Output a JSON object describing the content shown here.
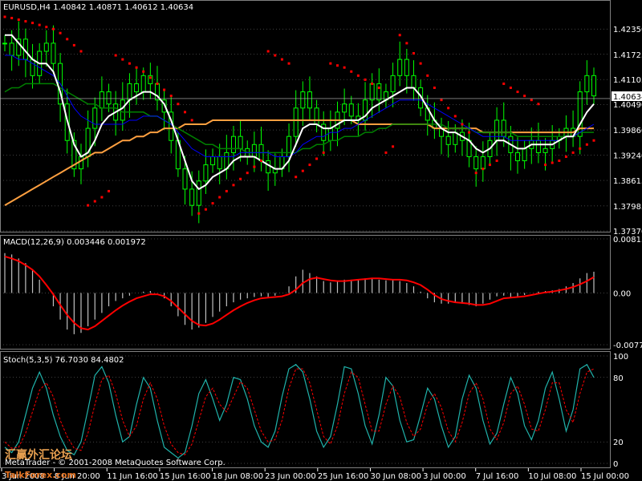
{
  "chart_data": {
    "type": "line",
    "symbol": "EURUSD,H4",
    "colors": {
      "background": "#000000",
      "candle_up": "#00ff00",
      "candle_down": "#00ff00",
      "ma_fast": "#ffffff",
      "ma_mid": "#0000ff",
      "ma_slow": "#008000",
      "ma_long": "#ffa040",
      "psar": "#ff0000",
      "macd_hist": "#c0c0c0",
      "macd_signal": "#ff0000",
      "stoch_main": "#20b2aa",
      "stoch_signal": "#ff0000",
      "grid": "#808080",
      "price_line": "#c0c0c0"
    },
    "price_pane": {
      "header": "EURUSD,H4  1.40842 1.40871 1.40612 1.40634",
      "current_price": "1.40634",
      "y_ticks": [
        "1.42350",
        "1.41725",
        "1.41105",
        "1.40490",
        "1.39860",
        "1.39240",
        "1.38615",
        "1.37985",
        "1.37370"
      ],
      "ylim": [
        1.3737,
        1.4267
      ]
    },
    "macd_pane": {
      "header": "MACD(12,26,9) 0.003446 0.001972",
      "y_ticks": [
        "0.008138",
        "0.00",
        "-0.00778"
      ],
      "ylim": [
        -0.00778,
        0.008138
      ]
    },
    "stoch_pane": {
      "header": "Stoch(5,3,5) 76.7030 84.4802",
      "y_ticks": [
        "100",
        "80",
        "20",
        "0"
      ],
      "ylim": [
        0,
        100
      ]
    },
    "x_ticks": [
      "3 Jun 2008",
      "8 Jun 20:00",
      "11 Jun 16:00",
      "15 Jun 16:00",
      "18 Jun 08:00",
      "23 Jun 00:00",
      "25 Jun 16:00",
      "30 Jun 08:00",
      "3 Jul 00:00",
      "7 Jul 16:00",
      "10 Jul 08:00",
      "15 Jul 00:00"
    ],
    "close": [
      1.42,
      1.417,
      1.421,
      1.416,
      1.412,
      1.418,
      1.42,
      1.415,
      1.405,
      1.396,
      1.389,
      1.392,
      1.399,
      1.404,
      1.408,
      1.405,
      1.401,
      1.406,
      1.41,
      1.408,
      1.412,
      1.41,
      1.406,
      1.403,
      1.396,
      1.389,
      1.384,
      1.38,
      1.386,
      1.39,
      1.392,
      1.389,
      1.393,
      1.397,
      1.394,
      1.392,
      1.395,
      1.391,
      1.388,
      1.389,
      1.392,
      1.397,
      1.404,
      1.408,
      1.404,
      1.4,
      1.396,
      1.399,
      1.403,
      1.405,
      1.402,
      1.401,
      1.406,
      1.41,
      1.406,
      1.408,
      1.412,
      1.416,
      1.412,
      1.409,
      1.404,
      1.401,
      1.399,
      1.397,
      1.395,
      1.398,
      1.396,
      1.392,
      1.389,
      1.392,
      1.396,
      1.401,
      1.397,
      1.393,
      1.391,
      1.394,
      1.396,
      1.393,
      1.394,
      1.396,
      1.397,
      1.399,
      1.397,
      1.408,
      1.412,
      1.407
    ],
    "fast_ma": [
      1.422,
      1.422,
      1.42,
      1.418,
      1.416,
      1.415,
      1.415,
      1.413,
      1.408,
      1.401,
      1.395,
      1.392,
      1.393,
      1.396,
      1.4,
      1.402,
      1.403,
      1.404,
      1.406,
      1.407,
      1.408,
      1.408,
      1.407,
      1.405,
      1.401,
      1.396,
      1.391,
      1.386,
      1.384,
      1.385,
      1.387,
      1.388,
      1.389,
      1.391,
      1.392,
      1.392,
      1.392,
      1.391,
      1.39,
      1.389,
      1.389,
      1.391,
      1.395,
      1.399,
      1.4,
      1.4,
      1.399,
      1.399,
      1.4,
      1.401,
      1.401,
      1.401,
      1.402,
      1.404,
      1.405,
      1.406,
      1.407,
      1.408,
      1.409,
      1.409,
      1.407,
      1.404,
      1.401,
      1.399,
      1.398,
      1.398,
      1.397,
      1.396,
      1.394,
      1.393,
      1.394,
      1.396,
      1.396,
      1.395,
      1.394,
      1.394,
      1.395,
      1.395,
      1.395,
      1.395,
      1.396,
      1.397,
      1.397,
      1.4,
      1.403,
      1.405
    ],
    "mid_ma": [
      1.417,
      1.417,
      1.416,
      1.416,
      1.415,
      1.414,
      1.413,
      1.412,
      1.41,
      1.407,
      1.404,
      1.402,
      1.401,
      1.4,
      1.4,
      1.4,
      1.4,
      1.4,
      1.401,
      1.401,
      1.402,
      1.402,
      1.402,
      1.401,
      1.4,
      1.398,
      1.396,
      1.394,
      1.393,
      1.392,
      1.392,
      1.392,
      1.392,
      1.392,
      1.393,
      1.393,
      1.393,
      1.393,
      1.393,
      1.392,
      1.392,
      1.392,
      1.393,
      1.395,
      1.396,
      1.397,
      1.397,
      1.398,
      1.398,
      1.399,
      1.399,
      1.4,
      1.401,
      1.402,
      1.403,
      1.404,
      1.405,
      1.406,
      1.406,
      1.406,
      1.406,
      1.405,
      1.404,
      1.403,
      1.402,
      1.401,
      1.4,
      1.399,
      1.398,
      1.397,
      1.397,
      1.397,
      1.397,
      1.396,
      1.396,
      1.396,
      1.396,
      1.396,
      1.396,
      1.396,
      1.396,
      1.397,
      1.397,
      1.398,
      1.399,
      1.4
    ],
    "slow_ma": [
      1.408,
      1.409,
      1.409,
      1.41,
      1.41,
      1.41,
      1.41,
      1.41,
      1.409,
      1.408,
      1.407,
      1.406,
      1.405,
      1.405,
      1.404,
      1.404,
      1.404,
      1.403,
      1.403,
      1.403,
      1.403,
      1.402,
      1.402,
      1.401,
      1.4,
      1.399,
      1.398,
      1.397,
      1.396,
      1.395,
      1.395,
      1.394,
      1.394,
      1.394,
      1.394,
      1.393,
      1.393,
      1.393,
      1.393,
      1.393,
      1.393,
      1.393,
      1.393,
      1.394,
      1.394,
      1.395,
      1.395,
      1.396,
      1.396,
      1.397,
      1.397,
      1.397,
      1.398,
      1.398,
      1.399,
      1.399,
      1.4,
      1.4,
      1.4,
      1.4,
      1.4,
      1.4,
      1.4,
      1.4,
      1.399,
      1.399,
      1.399,
      1.399,
      1.398,
      1.398,
      1.398,
      1.398,
      1.398,
      1.398,
      1.397,
      1.397,
      1.397,
      1.397,
      1.397,
      1.397,
      1.397,
      1.397,
      1.397,
      1.398,
      1.398,
      1.398
    ],
    "long_ma": [
      1.38,
      1.381,
      1.382,
      1.383,
      1.384,
      1.385,
      1.386,
      1.387,
      1.388,
      1.389,
      1.39,
      1.391,
      1.392,
      1.393,
      1.393,
      1.394,
      1.395,
      1.396,
      1.396,
      1.397,
      1.397,
      1.398,
      1.398,
      1.399,
      1.399,
      1.399,
      1.4,
      1.4,
      1.4,
      1.4,
      1.401,
      1.401,
      1.401,
      1.401,
      1.401,
      1.401,
      1.401,
      1.401,
      1.401,
      1.401,
      1.401,
      1.401,
      1.401,
      1.401,
      1.401,
      1.401,
      1.401,
      1.401,
      1.401,
      1.401,
      1.401,
      1.4,
      1.4,
      1.4,
      1.4,
      1.4,
      1.4,
      1.4,
      1.4,
      1.4,
      1.4,
      1.4,
      1.399,
      1.399,
      1.399,
      1.399,
      1.399,
      1.399,
      1.399,
      1.398,
      1.398,
      1.398,
      1.398,
      1.398,
      1.398,
      1.398,
      1.398,
      1.398,
      1.398,
      1.398,
      1.398,
      1.398,
      1.398,
      1.399,
      1.399,
      1.399
    ],
    "macd_hist": [
      0.006,
      0.0058,
      0.0052,
      0.0045,
      0.0035,
      0.002,
      0.0,
      -0.002,
      -0.004,
      -0.0055,
      -0.0062,
      -0.006,
      -0.005,
      -0.004,
      -0.003,
      -0.002,
      -0.0012,
      -0.0008,
      -0.0004,
      0.0,
      0.0002,
      0.0003,
      0.0,
      -0.0008,
      -0.002,
      -0.0035,
      -0.0048,
      -0.0055,
      -0.0052,
      -0.0045,
      -0.0036,
      -0.0028,
      -0.002,
      -0.0014,
      -0.001,
      -0.0008,
      -0.0006,
      -0.0005,
      -0.0006,
      -0.0004,
      0.0,
      0.001,
      0.0025,
      0.0035,
      0.003,
      0.0025,
      0.0018,
      0.0016,
      0.0018,
      0.002,
      0.002,
      0.0021,
      0.0022,
      0.0022,
      0.002,
      0.0019,
      0.002,
      0.0018,
      0.0015,
      0.001,
      0.0002,
      -0.0008,
      -0.0014,
      -0.0016,
      -0.0016,
      -0.0015,
      -0.0016,
      -0.0018,
      -0.002,
      -0.0016,
      -0.001,
      -0.0005,
      -0.0004,
      -0.0006,
      -0.0005,
      -0.0003,
      0.0,
      0.0002,
      0.0003,
      0.0004,
      0.0006,
      0.001,
      0.0015,
      0.0022,
      0.003,
      0.0032
    ],
    "macd_signal": [
      0.0055,
      0.0052,
      0.0048,
      0.0042,
      0.0035,
      0.0025,
      0.0012,
      -0.0002,
      -0.0018,
      -0.0033,
      -0.0045,
      -0.0053,
      -0.0055,
      -0.005,
      -0.0042,
      -0.0034,
      -0.0026,
      -0.0019,
      -0.0013,
      -0.0008,
      -0.0005,
      -0.0002,
      -0.0002,
      -0.0005,
      -0.0012,
      -0.0022,
      -0.0032,
      -0.0042,
      -0.0048,
      -0.0049,
      -0.0046,
      -0.004,
      -0.0033,
      -0.0026,
      -0.002,
      -0.0015,
      -0.0011,
      -0.0008,
      -0.0007,
      -0.0006,
      -0.0005,
      -0.0002,
      0.0005,
      0.0015,
      0.0021,
      0.0023,
      0.0021,
      0.0019,
      0.0018,
      0.0018,
      0.0019,
      0.002,
      0.0021,
      0.0022,
      0.0022,
      0.0021,
      0.002,
      0.002,
      0.0019,
      0.0016,
      0.0012,
      0.0005,
      -0.0003,
      -0.0009,
      -0.0012,
      -0.0014,
      -0.0015,
      -0.0016,
      -0.0018,
      -0.0018,
      -0.0016,
      -0.0012,
      -0.0008,
      -0.0007,
      -0.0006,
      -0.0005,
      -0.0003,
      -0.0001,
      0.0001,
      0.0002,
      0.0004,
      0.0006,
      0.0009,
      0.0013,
      0.0018,
      0.0024
    ],
    "stoch_main": [
      15,
      10,
      20,
      45,
      70,
      85,
      70,
      45,
      25,
      12,
      8,
      20,
      50,
      82,
      90,
      75,
      45,
      20,
      25,
      55,
      80,
      70,
      40,
      15,
      10,
      5,
      10,
      35,
      65,
      78,
      60,
      40,
      55,
      80,
      78,
      60,
      35,
      20,
      15,
      30,
      62,
      88,
      92,
      85,
      60,
      30,
      15,
      25,
      55,
      90,
      88,
      65,
      35,
      18,
      45,
      80,
      72,
      40,
      20,
      22,
      45,
      70,
      60,
      35,
      15,
      25,
      60,
      82,
      70,
      40,
      18,
      28,
      55,
      80,
      65,
      35,
      22,
      40,
      70,
      85,
      60,
      30,
      50,
      88,
      92,
      80
    ],
    "stoch_signal": [
      20,
      14,
      15,
      28,
      48,
      68,
      75,
      62,
      40,
      25,
      14,
      12,
      28,
      55,
      78,
      82,
      65,
      40,
      25,
      35,
      60,
      75,
      60,
      35,
      18,
      10,
      8,
      18,
      40,
      62,
      70,
      55,
      48,
      62,
      76,
      70,
      50,
      30,
      20,
      22,
      40,
      70,
      88,
      88,
      75,
      50,
      25,
      18,
      35,
      65,
      85,
      80,
      55,
      30,
      30,
      55,
      72,
      62,
      38,
      25,
      32,
      55,
      65,
      52,
      30,
      20,
      38,
      65,
      75,
      60,
      32,
      22,
      38,
      65,
      72,
      55,
      32,
      30,
      50,
      75,
      75,
      50,
      38,
      65,
      85,
      88
    ],
    "psar": [
      1.4265,
      1.4262,
      1.4258,
      1.4254,
      1.425,
      1.4245,
      1.424,
      1.4235,
      1.4225,
      1.421,
      1.4195,
      1.418,
      1.38,
      1.381,
      1.382,
      1.3835,
      1.417,
      1.416,
      1.415,
      1.414,
      1.413,
      1.4115,
      1.41,
      1.4085,
      1.407,
      1.405,
      1.403,
      1.401,
      1.378,
      1.379,
      1.3805,
      1.382,
      1.3835,
      1.385,
      1.3865,
      1.388,
      1.3895,
      1.391,
      1.418,
      1.417,
      1.416,
      1.415,
      1.387,
      1.3885,
      1.39,
      1.3915,
      1.393,
      1.415,
      1.4145,
      1.414,
      1.413,
      1.412,
      1.411,
      1.41,
      1.409,
      1.393,
      1.3945,
      1.422,
      1.42,
      1.4175,
      1.415,
      1.412,
      1.409,
      1.406,
      1.404,
      1.402,
      1.4,
      1.398,
      1.388,
      1.389,
      1.39,
      1.391,
      1.41,
      1.409,
      1.408,
      1.407,
      1.406,
      1.405,
      1.39,
      1.3905,
      1.391,
      1.392,
      1.393,
      1.394,
      1.395,
      1.396
    ]
  },
  "watermark": {
    "text": "MetaTrader - © 2001-2008 MetaQuotes Software Corp.",
    "cn": "汇赢外汇论坛",
    "url": "TalkForex.com"
  }
}
